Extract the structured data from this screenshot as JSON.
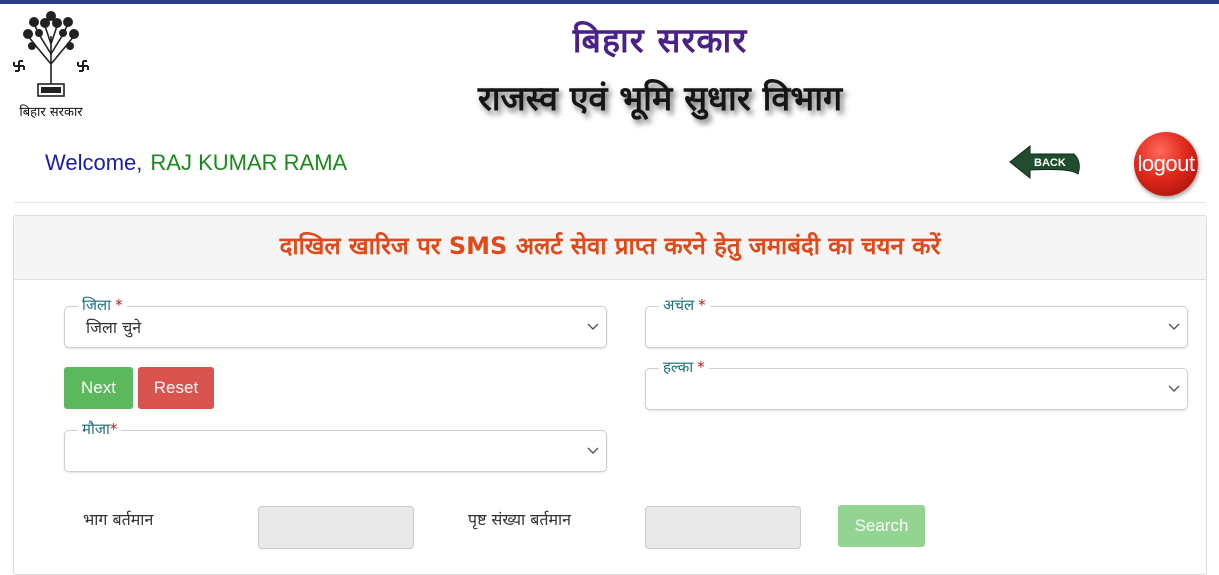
{
  "header": {
    "emblem_caption": "बिहार सरकार",
    "gov_title": "बिहार सरकार",
    "dept_title": "राजस्व एवं भूमि सुधार विभाग"
  },
  "user": {
    "welcome_label": "Welcome,",
    "name": "RAJ KUMAR RAMA"
  },
  "actions": {
    "back_label": "BACK",
    "logout_label": "logout"
  },
  "form": {
    "title": "दाखिल खारिज पर SMS अलर्ट सेवा प्राप्त करने हेतु जमाबंदी का चयन करें",
    "required_mark": "*",
    "district": {
      "label": "जिला",
      "value": "जिला चुने"
    },
    "circle": {
      "label": "अचंल",
      "value": ""
    },
    "halka": {
      "label": "हल्का",
      "value": ""
    },
    "mauja": {
      "label": "मौजा",
      "value": ""
    },
    "next_label": "Next",
    "reset_label": "Reset",
    "bhag_label": "भाग बर्तमान",
    "page_label": "पृष्ट संख्या बर्तमान",
    "search_label": "Search"
  },
  "colors": {
    "gov_title": "#4a2186",
    "title_orange": "#e04a1b",
    "next_green": "#5cb85c",
    "reset_red": "#d9534f",
    "search_green_disabled": "#93d493",
    "welcome_blue": "#1b1bb0",
    "username_green": "#1a8a1a"
  },
  "icons": [
    "bodhi-tree-emblem-icon",
    "back-arrow-icon",
    "chevron-down-icon"
  ]
}
